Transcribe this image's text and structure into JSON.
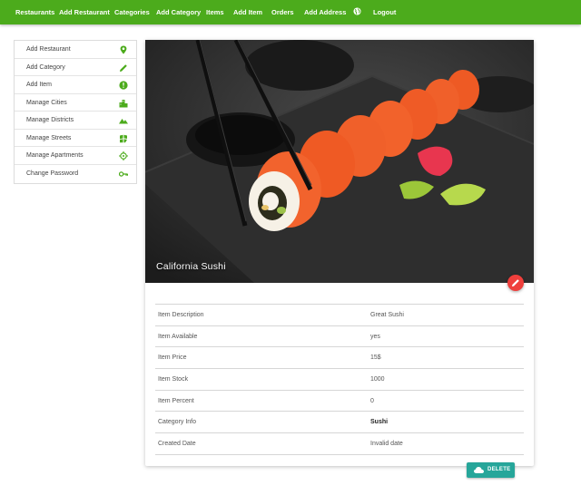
{
  "nav": {
    "items": [
      {
        "label": "Restaurants"
      },
      {
        "label": "Add Restaurant"
      },
      {
        "label": "Categories"
      },
      {
        "label": "Add Category"
      },
      {
        "label": "Items"
      },
      {
        "label": "Add Item"
      },
      {
        "label": "Orders"
      },
      {
        "label": "Add Address"
      }
    ],
    "globe_icon": "globe-icon",
    "logout": "Logout",
    "bg_color": "#4cab1c"
  },
  "sidebar": {
    "items": [
      {
        "label": "Add Restaurant",
        "icon": "map-pin-icon"
      },
      {
        "label": "Add Category",
        "icon": "pencil-icon"
      },
      {
        "label": "Add Item",
        "icon": "info-icon"
      },
      {
        "label": "Manage Cities",
        "icon": "city-icon"
      },
      {
        "label": "Manage Districts",
        "icon": "terrain-icon"
      },
      {
        "label": "Manage Streets",
        "icon": "map-icon"
      },
      {
        "label": "Manage Apartments",
        "icon": "crosshair-icon"
      },
      {
        "label": "Change Password",
        "icon": "key-icon"
      }
    ],
    "icon_color": "#4cab1c"
  },
  "item": {
    "title": "California Sushi",
    "details": [
      {
        "label": "Item Description",
        "value": "Great Sushi"
      },
      {
        "label": "Item Available",
        "value": "yes"
      },
      {
        "label": "Item Price",
        "value": "15$"
      },
      {
        "label": "Item Stock",
        "value": "1000"
      },
      {
        "label": "Item Percent",
        "value": "0"
      },
      {
        "label": "Category Info",
        "value": "Sushi"
      },
      {
        "label": "Created Date",
        "value": "Invalid date"
      }
    ]
  },
  "actions": {
    "delete_label": "DELETE",
    "delete_color": "#26a69a",
    "edit_color": "#ef3f3c"
  }
}
